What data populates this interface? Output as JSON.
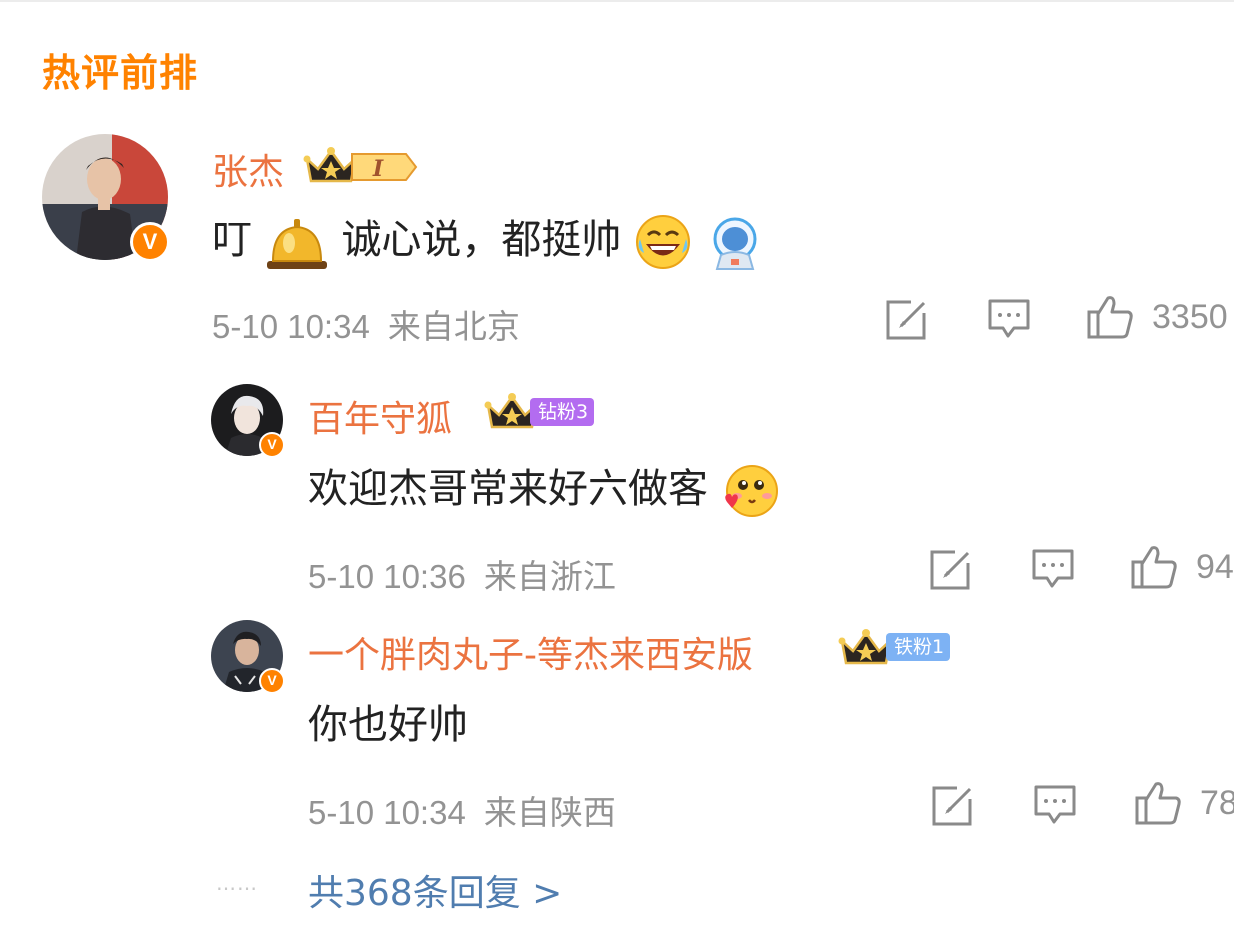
{
  "section": {
    "title": "热评前排"
  },
  "comments": [
    {
      "username": "张杰",
      "level_badge": "I",
      "content": "叮",
      "content_after_bell": "诚心说，都挺帅",
      "time": "5-10 10:34",
      "location": "来自北京",
      "likes": "3350"
    },
    {
      "username": "百年守狐",
      "fan_badge": "钻粉3",
      "content": "欢迎杰哥常来好六做客",
      "time": "5-10 10:36",
      "location": "来自浙江",
      "likes": "94"
    },
    {
      "username": "一个胖肉丸子-等杰来西安版",
      "fan_badge": "铁粉1",
      "content": "你也好帅",
      "time": "5-10 10:34",
      "location": "来自陕西",
      "likes": "78"
    }
  ],
  "more": {
    "dots": "……",
    "label": "共368条回复 >"
  },
  "verified_badge": "V",
  "icons": [
    "edit-icon",
    "comment-icon",
    "like-icon",
    "crown-icon",
    "bell-emoji",
    "laughing-emoji",
    "astronaut-emoji",
    "love-face-emoji"
  ],
  "colors": {
    "accent": "#ff8200",
    "username": "#eb7340",
    "meta": "#939393",
    "link": "#507daf",
    "diamond_badge": "#b36cf0",
    "iron_badge": "#7db2f4"
  }
}
